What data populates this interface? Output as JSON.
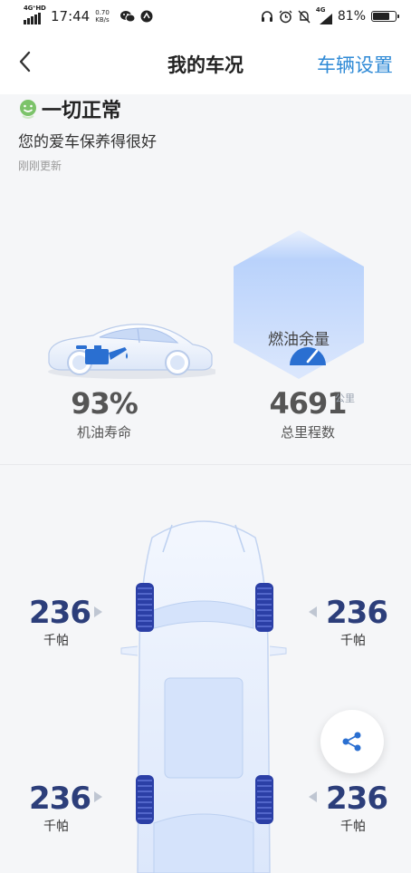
{
  "status_bar": {
    "network_label": "4G⁺HD",
    "time": "17:44",
    "net_speed_value": "0.70",
    "net_speed_unit": "KB/s",
    "icons_left": [
      "wechat-icon",
      "app-notification-icon"
    ],
    "icons_right": [
      "headphones-icon",
      "alarm-icon",
      "mute-icon",
      "4g-signal-icon"
    ],
    "network_right": "4G",
    "battery_percent": "81%",
    "battery_level": 0.81
  },
  "header": {
    "back_icon": "chevron-left-icon",
    "title": "我的车况",
    "settings_label": "车辆设置"
  },
  "summary": {
    "status_title": "一切正常",
    "status_desc": "您的爱车保养得很好",
    "updated": "刚刚更新",
    "fuel_label": "燃油余量"
  },
  "stats": {
    "oil": {
      "icon": "oil-can-icon",
      "value": "93%",
      "label": "机油寿命"
    },
    "mileage": {
      "icon": "speedometer-icon",
      "value": "4691",
      "unit": "公里",
      "label": "总里程数"
    }
  },
  "tires": {
    "front_left": {
      "value": "236",
      "unit": "千帕"
    },
    "front_right": {
      "value": "236",
      "unit": "千帕"
    },
    "rear_left": {
      "value": "236",
      "unit": "千帕"
    },
    "rear_right": {
      "value": "236",
      "unit": "千帕"
    }
  },
  "colors": {
    "accent": "#2f8ad6",
    "pressure_text": "#2c3e7a",
    "icon_blue": "#2a6fd1",
    "status_green": "#7cc36a"
  },
  "share_icon": "share-icon"
}
